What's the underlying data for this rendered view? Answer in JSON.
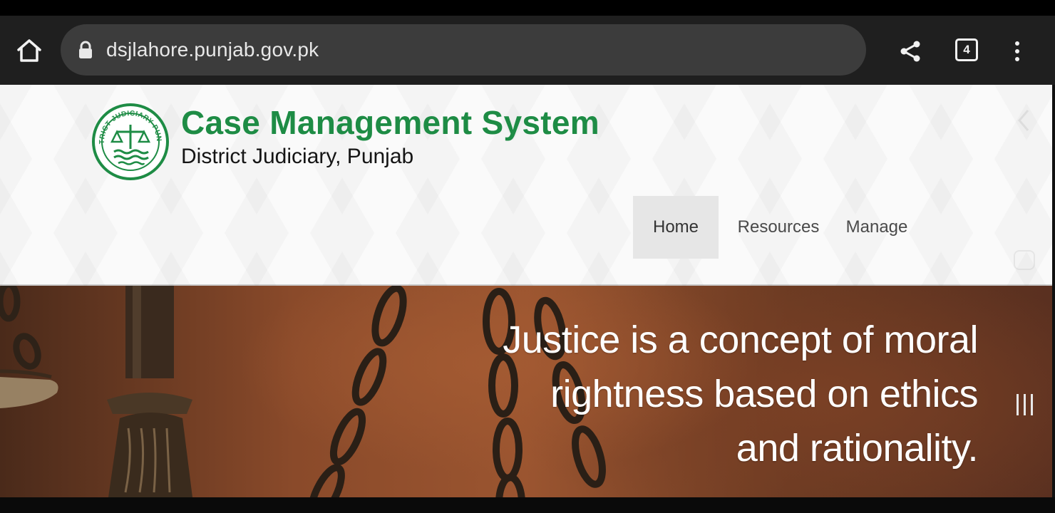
{
  "browser": {
    "url": "dsjlahore.punjab.gov.pk",
    "tab_count": "4",
    "icons": {
      "home": "home-icon",
      "lock": "lock-icon",
      "share": "share-icon",
      "tabs": "tab-switcher-icon",
      "menu": "more-vert-icon"
    }
  },
  "header": {
    "title": "Case Management System",
    "subtitle": "District Judiciary, Punjab",
    "logo_text": "DISTRICT JUDICIARY PUNJAB",
    "title_color": "#1e8c45"
  },
  "nav": {
    "items": [
      {
        "label": "Home",
        "active": true
      },
      {
        "label": "Resources",
        "active": false
      },
      {
        "label": "Manage",
        "active": false
      }
    ]
  },
  "hero": {
    "quote_lines": [
      "Justice is a concept of moral",
      "rightness based on ethics",
      "and rationality."
    ]
  },
  "colors": {
    "brand_green": "#1e8c45",
    "browser_bar": "#1f1f1f",
    "url_pill": "#3c3c3c",
    "nav_active_bg": "#e6e6e6"
  }
}
